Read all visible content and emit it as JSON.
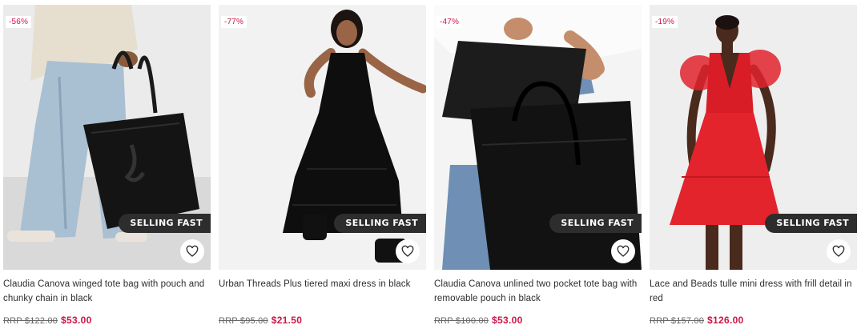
{
  "badges": {
    "selling_fast": "SELLING FAST"
  },
  "colors": {
    "sale_red": "#d01345",
    "badge_dark": "#2d2d2d",
    "text": "#2d2d2d"
  },
  "products": [
    {
      "discount": "-56%",
      "title": "Claudia Canova winged tote bag with pouch and chunky chain in black",
      "rrp": "RRP $122.00",
      "price": "$53.00",
      "icon": "heart-icon"
    },
    {
      "discount": "-77%",
      "title": "Urban Threads Plus tiered maxi dress in black",
      "rrp": "RRP $95.00",
      "price": "$21.50",
      "icon": "heart-icon"
    },
    {
      "discount": "-47%",
      "title": "Claudia Canova unlined two pocket tote bag with removable pouch in black",
      "rrp": "RRP $100.00",
      "price": "$53.00",
      "icon": "heart-icon"
    },
    {
      "discount": "-19%",
      "title": "Lace and Beads tulle mini dress with frill detail in red",
      "rrp": "RRP $157.00",
      "price": "$126.00",
      "icon": "heart-icon"
    }
  ]
}
